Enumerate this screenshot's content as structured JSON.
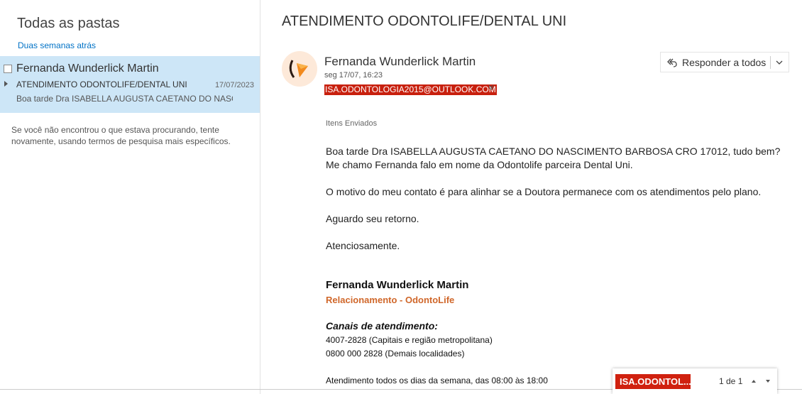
{
  "left": {
    "folder_title": "Todas as pastas",
    "group_header": "Duas semanas atrás",
    "item": {
      "sender": "Fernanda Wunderlick Martin",
      "subject": "ATENDIMENTO ODONTOLIFE/DENTAL UNI",
      "date": "17/07/2023",
      "preview": "Boa tarde Dra ISABELLA AUGUSTA CAETANO DO NASCI..."
    },
    "no_results": "Se você não encontrou o que estava procurando, tente novamente, usando termos de pesquisa mais específicos."
  },
  "message": {
    "subject": "ATENDIMENTO ODONTOLIFE/DENTAL UNI",
    "sender": "Fernanda Wunderlick Martin",
    "date": "seg 17/07, 16:23",
    "recipient": "ISA.ODONTOLOGIA2015@OUTLOOK.COM",
    "reply_all_label": "Responder a todos",
    "folder": "Itens Enviados",
    "body": {
      "line1": "Boa tarde Dra ISABELLA AUGUSTA CAETANO DO NASCIMENTO BARBOSA CRO 17012, tudo bem?",
      "line2": "Me chamo Fernanda falo em nome da Odontolife parceira Dental Uni.",
      "line3": "O motivo do meu contato é para alinhar se a Doutora permanece com os atendimentos pelo plano.",
      "line4": "Aguardo seu retorno.",
      "line5": "Atenciosamente."
    },
    "signature": {
      "name": "Fernanda Wunderlick Martin",
      "role": "Relacionamento - OdontoLife",
      "channels_title": "Canais de atendimento:",
      "phone1": "4007-2828 (Capitais e região metropolitana)",
      "phone2": "0800 000 2828 (Demais localidades)",
      "hours": "Atendimento todos os dias da semana, das 08:00 às 18:00"
    }
  },
  "notification": {
    "tag": "ISA.ODONTOL...",
    "count": "1 de 1"
  },
  "colors": {
    "accent": "#0072c6",
    "selected_item": "#cde6f7",
    "redaction": "#c8200e",
    "signature_role": "#d0672a"
  }
}
